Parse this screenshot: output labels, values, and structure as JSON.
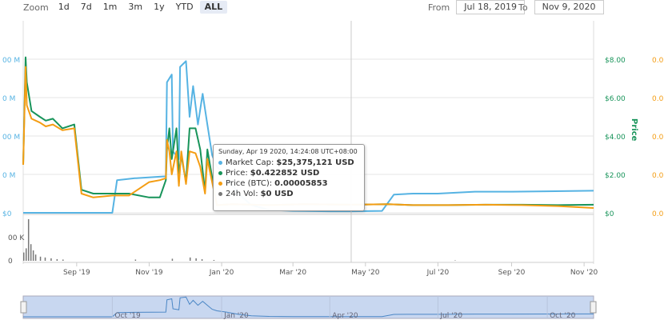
{
  "zoom": {
    "label": "Zoom",
    "buttons": [
      "1d",
      "7d",
      "1m",
      "3m",
      "1y",
      "YTD",
      "ALL"
    ],
    "active": "ALL"
  },
  "range": {
    "from_label": "From",
    "from_value": "Jul 18, 2019",
    "to_label": "To",
    "to_value": "Nov 9, 2020"
  },
  "colors": {
    "market_cap": "#56b3e3",
    "price": "#18945a",
    "price_btc": "#f49d13",
    "volume": "#777777",
    "navigator_fill": "#c8d7f0"
  },
  "tooltip": {
    "header": "Sunday, Apr 19 2020, 14:24:08 UTC+08:00",
    "rows": [
      {
        "label": "Market Cap:",
        "value": "$25,375,121 USD"
      },
      {
        "label": "Price:",
        "value": "$0.422852 USD"
      },
      {
        "label": "Price (BTC):",
        "value": "0.00005853"
      },
      {
        "label": "24h Vol:",
        "value": "$0 USD"
      }
    ]
  },
  "chart_data": {
    "type": "line",
    "x_range": [
      "2019-07-18",
      "2020-11-09"
    ],
    "x_ticks": [
      "Sep '19",
      "Nov '19",
      "Jan '20",
      "Mar '20",
      "May '20",
      "Jul '20",
      "Sep '20",
      "Nov '20"
    ],
    "navigator_ticks": [
      "Oct '19",
      "Jan '20",
      "Apr '20",
      "Jul '20",
      "Oct '20"
    ],
    "y_left_ticks": [
      "00 M",
      "0 M",
      "00 M",
      "0 M",
      "$0"
    ],
    "y_price_ticks": [
      "$0",
      "$2.00",
      "$4.00",
      "$6.00",
      "$8.00"
    ],
    "y_price_label": "Price",
    "y_btc_ticks": [
      "0.00",
      "0.00",
      "0.00",
      "0.00",
      "0.00",
      "0.00"
    ],
    "y_volume_ticks": [
      "0",
      "00 K"
    ],
    "ylim_price": [
      0,
      8
    ],
    "grid": true,
    "series": [
      {
        "name": "Market Cap",
        "x": [
          "2019-07-18",
          "2019-08-10",
          "2019-09-01",
          "2019-10-01",
          "2019-10-05",
          "2019-10-20",
          "2019-10-21",
          "2019-11-15",
          "2019-11-16",
          "2019-11-20",
          "2019-11-21",
          "2019-11-26",
          "2019-11-27",
          "2019-12-02",
          "2019-12-05",
          "2019-12-08",
          "2019-12-12",
          "2019-12-16",
          "2019-12-20",
          "2019-12-24",
          "2019-12-28",
          "2020-01-05",
          "2020-01-15",
          "2020-01-26",
          "2020-02-10",
          "2020-03-01",
          "2020-04-01",
          "2020-04-19",
          "2020-05-15",
          "2020-05-25",
          "2020-06-10",
          "2020-07-01",
          "2020-08-01",
          "2020-09-01",
          "2020-10-01",
          "2020-11-09"
        ],
        "values": [
          0,
          0,
          0,
          0,
          1.7,
          1.8,
          1.8,
          1.9,
          6.8,
          7.2,
          3.2,
          2.8,
          7.6,
          7.9,
          5.0,
          6.6,
          4.6,
          6.2,
          4.6,
          3.0,
          2.4,
          1.9,
          1.0,
          0.4,
          0.15,
          0.1,
          0.08,
          0.08,
          0.1,
          0.95,
          1.0,
          1.0,
          1.1,
          1.1,
          1.12,
          1.15
        ]
      },
      {
        "name": "Price",
        "x": [
          "2019-07-18",
          "2019-07-20",
          "2019-07-21",
          "2019-07-25",
          "2019-08-01",
          "2019-08-06",
          "2019-08-12",
          "2019-08-20",
          "2019-08-30",
          "2019-09-05",
          "2019-09-15",
          "2019-10-01",
          "2019-10-15",
          "2019-11-01",
          "2019-11-10",
          "2019-11-15",
          "2019-11-16",
          "2019-11-18",
          "2019-11-20",
          "2019-11-24",
          "2019-11-26",
          "2019-11-28",
          "2019-12-02",
          "2019-12-05",
          "2019-12-10",
          "2019-12-14",
          "2019-12-18",
          "2019-12-20",
          "2019-12-28",
          "2020-01-10",
          "2020-02-10",
          "2020-03-10",
          "2020-04-19",
          "2020-05-20",
          "2020-06-10",
          "2020-07-10",
          "2020-08-10",
          "2020-09-10",
          "2020-10-10",
          "2020-11-09"
        ],
        "values": [
          2.5,
          8.1,
          6.8,
          5.3,
          5.0,
          4.8,
          4.9,
          4.4,
          4.6,
          1.2,
          1.0,
          1.0,
          1.0,
          0.8,
          0.8,
          1.7,
          3.3,
          4.4,
          2.8,
          4.4,
          2.0,
          3.0,
          1.6,
          4.4,
          4.4,
          3.3,
          1.1,
          3.3,
          0.4,
          0.45,
          0.4,
          0.45,
          0.42,
          0.45,
          0.4,
          0.4,
          0.42,
          0.42,
          0.4,
          0.42
        ]
      },
      {
        "name": "Price (BTC)",
        "x": [
          "2019-07-18",
          "2019-07-20",
          "2019-07-21",
          "2019-07-25",
          "2019-08-01",
          "2019-08-06",
          "2019-08-12",
          "2019-08-20",
          "2019-08-30",
          "2019-09-05",
          "2019-09-15",
          "2019-10-01",
          "2019-10-15",
          "2019-11-01",
          "2019-11-10",
          "2019-11-15",
          "2019-11-16",
          "2019-11-18",
          "2019-11-20",
          "2019-11-24",
          "2019-11-26",
          "2019-11-28",
          "2019-12-02",
          "2019-12-05",
          "2019-12-10",
          "2019-12-14",
          "2019-12-18",
          "2019-12-20",
          "2019-12-28",
          "2020-01-10",
          "2020-02-10",
          "2020-03-10",
          "2020-04-19",
          "2020-05-20",
          "2020-06-10",
          "2020-07-10",
          "2020-08-10",
          "2020-09-10",
          "2020-10-10",
          "2020-11-09"
        ],
        "values": [
          2.5,
          7.6,
          5.6,
          4.9,
          4.7,
          4.5,
          4.6,
          4.3,
          4.4,
          1.0,
          0.8,
          0.9,
          0.9,
          1.6,
          1.7,
          1.8,
          3.8,
          3.2,
          2.0,
          3.2,
          1.4,
          3.2,
          1.5,
          3.2,
          3.1,
          2.4,
          1.0,
          2.8,
          0.4,
          0.45,
          0.4,
          0.45,
          0.42,
          0.45,
          0.4,
          0.4,
          0.42,
          0.4,
          0.35,
          0.25
        ]
      }
    ],
    "volume": {
      "name": "24h Vol",
      "x": [
        "2019-07-18",
        "2019-07-20",
        "2019-07-22",
        "2019-07-24",
        "2019-07-26",
        "2019-07-28",
        "2019-08-01",
        "2019-08-05",
        "2019-08-10",
        "2019-08-15",
        "2019-08-20",
        "2019-10-20",
        "2019-11-20",
        "2019-12-05",
        "2019-12-10",
        "2019-12-15",
        "2019-12-25",
        "2020-02-01",
        "2020-04-19",
        "2020-07-15"
      ],
      "values": [
        20,
        30,
        100,
        40,
        25,
        15,
        10,
        8,
        6,
        4,
        3,
        3,
        5,
        8,
        6,
        4,
        2,
        0,
        0,
        1
      ]
    }
  }
}
